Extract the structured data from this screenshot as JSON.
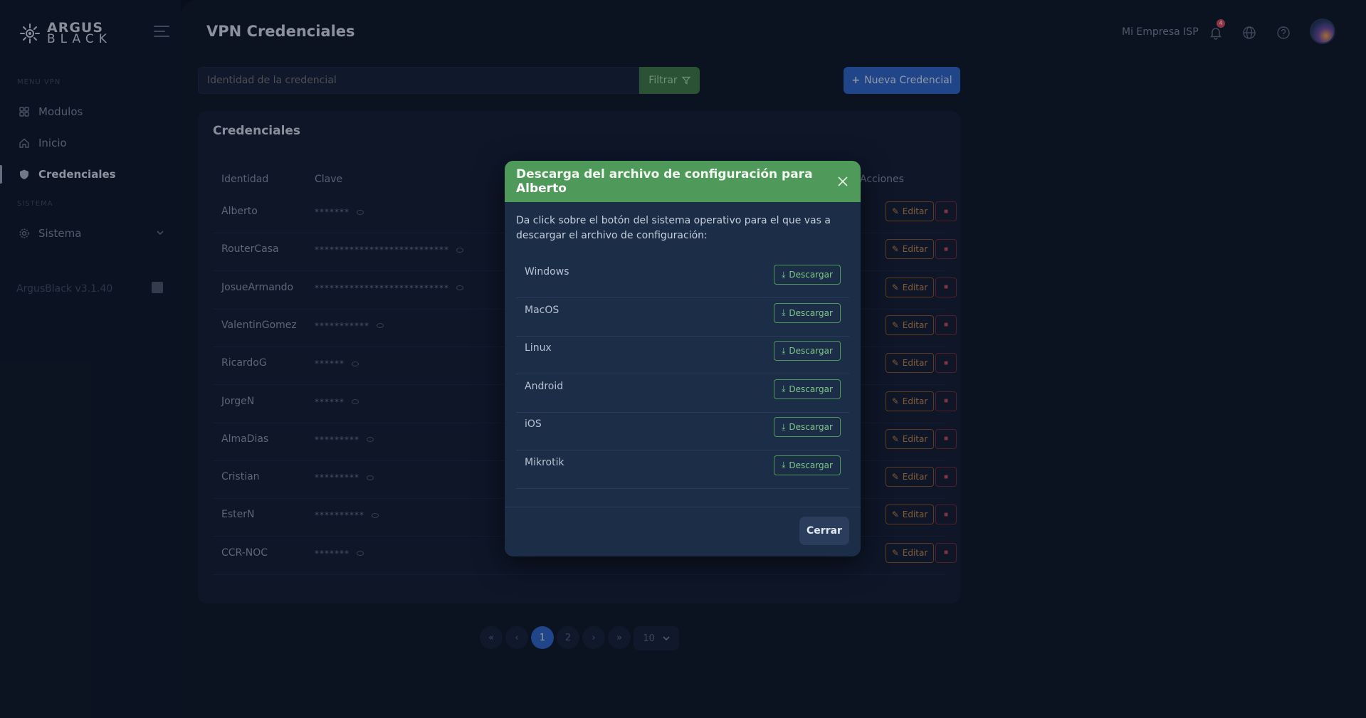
{
  "brand": {
    "line1": "ARGUS",
    "line2": "BLACK"
  },
  "sidebar": {
    "section_vpn": "MENU VPN",
    "section_system": "SISTEMA",
    "items": [
      {
        "label": "Modulos"
      },
      {
        "label": "Inicio"
      },
      {
        "label": "Credenciales"
      },
      {
        "label": "Sistema"
      }
    ],
    "version": "ArgusBlack v3.1.40"
  },
  "header": {
    "title": "VPN Credenciales",
    "company": "Mi Empresa ISP",
    "notification_count": "4"
  },
  "search": {
    "placeholder": "Identidad de la credencial"
  },
  "buttons": {
    "filter": "Filtrar",
    "new_credential": "Nueva Credencial",
    "edit": "Editar"
  },
  "card": {
    "title": "Credenciales",
    "columns": {
      "identidad": "Identidad",
      "clave": "Clave",
      "acciones": "Acciones"
    }
  },
  "rows": [
    {
      "identity": "Alberto",
      "password": "*******"
    },
    {
      "identity": "RouterCasa",
      "password": "***************************"
    },
    {
      "identity": "JosueArmando",
      "password": "***************************"
    },
    {
      "identity": "ValentinGomez",
      "password": "***********"
    },
    {
      "identity": "RicardoG",
      "password": "******"
    },
    {
      "identity": "JorgeN",
      "password": "******"
    },
    {
      "identity": "AlmaDias",
      "password": "*********"
    },
    {
      "identity": "Cristian",
      "password": "*********"
    },
    {
      "identity": "EsterN",
      "password": "**********"
    },
    {
      "identity": "CCR-NOC",
      "password": "*******"
    }
  ],
  "pagination": {
    "first": "«",
    "prev": "‹",
    "pages": [
      "1",
      "2"
    ],
    "next": "›",
    "last": "»",
    "page_size": "10"
  },
  "modal": {
    "title_prefix": "Descarga del archivo de configuración para ",
    "title_name": "Alberto",
    "description": "Da click sobre el botón del sistema operativo para el que vas a descargar el archivo de configuración:",
    "download_label": "Descargar",
    "os_list": [
      "Windows",
      "MacOS",
      "Linux",
      "Android",
      "iOS",
      "Mikrotik"
    ],
    "close_label": "Cerrar"
  }
}
